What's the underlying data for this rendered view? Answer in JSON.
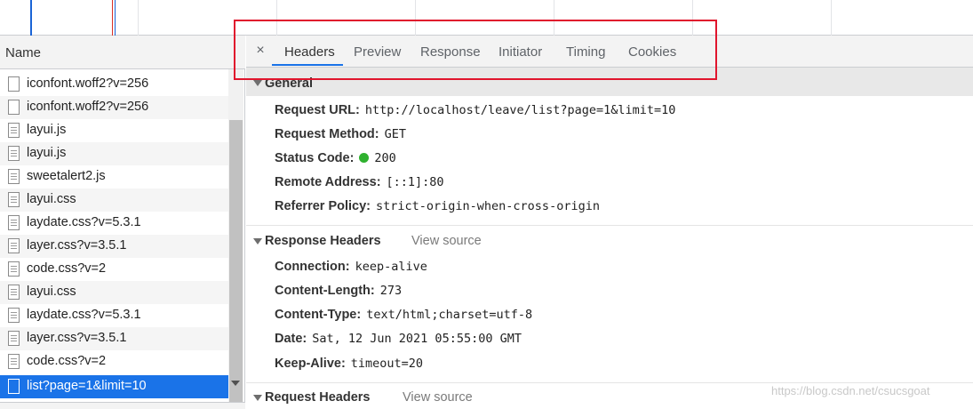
{
  "timeline": {},
  "request_list": {
    "column_header": "Name",
    "items": [
      {
        "label": "iconfont.woff2?v=256",
        "kind": "file"
      },
      {
        "label": "iconfont.woff2?v=256",
        "kind": "file"
      },
      {
        "label": "layui.js",
        "kind": "script"
      },
      {
        "label": "layui.js",
        "kind": "script"
      },
      {
        "label": "sweetalert2.js",
        "kind": "script"
      },
      {
        "label": "layui.css",
        "kind": "script"
      },
      {
        "label": "laydate.css?v=5.3.1",
        "kind": "script"
      },
      {
        "label": "layer.css?v=3.5.1",
        "kind": "script"
      },
      {
        "label": "code.css?v=2",
        "kind": "script"
      },
      {
        "label": "layui.css",
        "kind": "script"
      },
      {
        "label": "laydate.css?v=5.3.1",
        "kind": "script"
      },
      {
        "label": "layer.css?v=3.5.1",
        "kind": "script"
      },
      {
        "label": "code.css?v=2",
        "kind": "script"
      },
      {
        "label": "list?page=1&limit=10",
        "kind": "file",
        "selected": true
      }
    ]
  },
  "tabs": {
    "close_glyph": "×",
    "items": [
      "Headers",
      "Preview",
      "Response",
      "Initiator",
      "Timing",
      "Cookies"
    ],
    "active": "Headers"
  },
  "general": {
    "title": "General",
    "rows": [
      {
        "key": "Request URL:",
        "value": "http://localhost/leave/list?page=1&limit=10"
      },
      {
        "key": "Request Method:",
        "value": "GET"
      },
      {
        "key": "Status Code:",
        "value": "200"
      },
      {
        "key": "Remote Address:",
        "value": "[::1]:80"
      },
      {
        "key": "Referrer Policy:",
        "value": "strict-origin-when-cross-origin"
      }
    ]
  },
  "response_headers": {
    "title": "Response Headers",
    "view_source": "View source",
    "rows": [
      {
        "key": "Connection:",
        "value": "keep-alive"
      },
      {
        "key": "Content-Length:",
        "value": "273"
      },
      {
        "key": "Content-Type:",
        "value": "text/html;charset=utf-8"
      },
      {
        "key": "Date:",
        "value": "Sat, 12 Jun 2021 05:55:00 GMT"
      },
      {
        "key": "Keep-Alive:",
        "value": "timeout=20"
      }
    ]
  },
  "request_headers": {
    "title": "Request Headers",
    "view_source": "View source"
  },
  "watermark": "https://blog.csdn.net/csucsgoat",
  "colors": {
    "accent": "#1a73e8",
    "highlight_box": "#e0152d",
    "status_ok": "#2fb12f"
  }
}
